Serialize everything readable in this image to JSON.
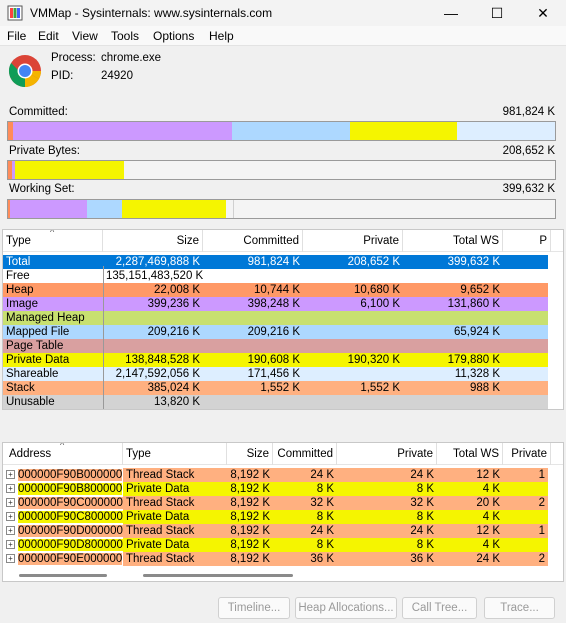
{
  "window": {
    "title": "VMMap - Sysinternals: www.sysinternals.com",
    "minimize": "—",
    "maximize": "☐",
    "close": "✕"
  },
  "menu": [
    "File",
    "Edit",
    "View",
    "Tools",
    "Options",
    "Help"
  ],
  "process": {
    "process_label": "Process:",
    "process_value": "chrome.exe",
    "pid_label": "PID:",
    "pid_value": "24920"
  },
  "meters": [
    {
      "label": "Committed:",
      "value": "981,824 K",
      "segments": [
        {
          "color": "#ff8c5a",
          "fraction": 0.01
        },
        {
          "color": "#cc99ff",
          "fraction": 0.4
        },
        {
          "color": "#add8ff",
          "fraction": 0.215
        },
        {
          "color": "#f5f500",
          "fraction": 0.195
        },
        {
          "color": "#ddeeff",
          "fraction": 0.18
        }
      ]
    },
    {
      "label": "Private Bytes:",
      "value": "208,652 K",
      "segments": [
        {
          "color": "#ff8c5a",
          "fraction": 0.007
        },
        {
          "color": "#cc99ff",
          "fraction": 0.005
        },
        {
          "color": "#f5f500",
          "fraction": 0.2
        }
      ]
    },
    {
      "label": "Working Set:",
      "value": "399,632 K",
      "segments": [
        {
          "color": "#ff8c5a",
          "fraction": 0.004
        },
        {
          "color": "#cc99ff",
          "fraction": 0.14
        },
        {
          "color": "#add8ff",
          "fraction": 0.065
        },
        {
          "color": "#f5f500",
          "fraction": 0.19
        },
        {
          "color": "#f4f4f4",
          "fraction": 0.012
        },
        {
          "color": "#d0d0d0",
          "fraction": 0.002
        }
      ]
    }
  ],
  "summary": {
    "columns": [
      "Type",
      "Size",
      "Committed",
      "Private",
      "Total WS",
      "P"
    ],
    "rows": [
      {
        "type": "Total",
        "size": "2,287,469,888 K",
        "committed": "981,824 K",
        "private": "208,652 K",
        "total_ws": "399,632 K",
        "bg": "#0078d7",
        "fg": "#ffffff"
      },
      {
        "type": "Free",
        "size": "135,151,483,520 K",
        "committed": "",
        "private": "",
        "total_ws": "",
        "bg": "#ffffff",
        "fg": "#000000"
      },
      {
        "type": "Heap",
        "size": "22,008 K",
        "committed": "10,744 K",
        "private": "10,680 K",
        "total_ws": "9,652 K",
        "bg": "#ff9966",
        "fg": "#000000"
      },
      {
        "type": "Image",
        "size": "399,236 K",
        "committed": "398,248 K",
        "private": "6,100 K",
        "total_ws": "131,860 K",
        "bg": "#cc99ff",
        "fg": "#000000"
      },
      {
        "type": "Managed Heap",
        "size": "",
        "committed": "",
        "private": "",
        "total_ws": "",
        "bg": "#c8e070",
        "fg": "#000000"
      },
      {
        "type": "Mapped File",
        "size": "209,216 K",
        "committed": "209,216 K",
        "private": "",
        "total_ws": "65,924 K",
        "bg": "#add8ff",
        "fg": "#000000"
      },
      {
        "type": "Page Table",
        "size": "",
        "committed": "",
        "private": "",
        "total_ws": "",
        "bg": "#d9a0a0",
        "fg": "#000000"
      },
      {
        "type": "Private Data",
        "size": "138,848,528 K",
        "committed": "190,608 K",
        "private": "190,320 K",
        "total_ws": "179,880 K",
        "bg": "#f5f500",
        "fg": "#000000"
      },
      {
        "type": "Shareable",
        "size": "2,147,592,056 K",
        "committed": "171,456 K",
        "private": "",
        "total_ws": "11,328 K",
        "bg": "#ddeeff",
        "fg": "#000000"
      },
      {
        "type": "Stack",
        "size": "385,024 K",
        "committed": "1,552 K",
        "private": "1,552 K",
        "total_ws": "988 K",
        "bg": "#ffb080",
        "fg": "#000000"
      },
      {
        "type": "Unusable",
        "size": "13,820 K",
        "committed": "",
        "private": "",
        "total_ws": "",
        "bg": "#d3d3d3",
        "fg": "#000000"
      }
    ]
  },
  "details": {
    "columns": [
      "Address",
      "Type",
      "Size",
      "Committed",
      "Private",
      "Total WS",
      "Private"
    ],
    "expander": "+",
    "rows": [
      {
        "address": "000000F90B000000",
        "type": "Thread Stack",
        "size": "8,192 K",
        "committed": "24 K",
        "private": "24 K",
        "total_ws": "12 K",
        "private_ws": "1",
        "bg": "#ffb080"
      },
      {
        "address": "000000F90B800000",
        "type": "Private Data",
        "size": "8,192 K",
        "committed": "8 K",
        "private": "8 K",
        "total_ws": "4 K",
        "private_ws": "",
        "bg": "#f5f500"
      },
      {
        "address": "000000F90C000000",
        "type": "Thread Stack",
        "size": "8,192 K",
        "committed": "32 K",
        "private": "32 K",
        "total_ws": "20 K",
        "private_ws": "2",
        "bg": "#ffb080"
      },
      {
        "address": "000000F90C800000",
        "type": "Private Data",
        "size": "8,192 K",
        "committed": "8 K",
        "private": "8 K",
        "total_ws": "4 K",
        "private_ws": "",
        "bg": "#f5f500"
      },
      {
        "address": "000000F90D000000",
        "type": "Thread Stack",
        "size": "8,192 K",
        "committed": "24 K",
        "private": "24 K",
        "total_ws": "12 K",
        "private_ws": "1",
        "bg": "#ffb080"
      },
      {
        "address": "000000F90D800000",
        "type": "Private Data",
        "size": "8,192 K",
        "committed": "8 K",
        "private": "8 K",
        "total_ws": "4 K",
        "private_ws": "",
        "bg": "#f5f500"
      },
      {
        "address": "000000F90E000000",
        "type": "Thread Stack",
        "size": "8,192 K",
        "committed": "36 K",
        "private": "36 K",
        "total_ws": "24 K",
        "private_ws": "2",
        "bg": "#ffb080"
      }
    ]
  },
  "buttons": {
    "timeline": "Timeline...",
    "heap": "Heap Allocations...",
    "calltree": "Call Tree...",
    "trace": "Trace..."
  }
}
